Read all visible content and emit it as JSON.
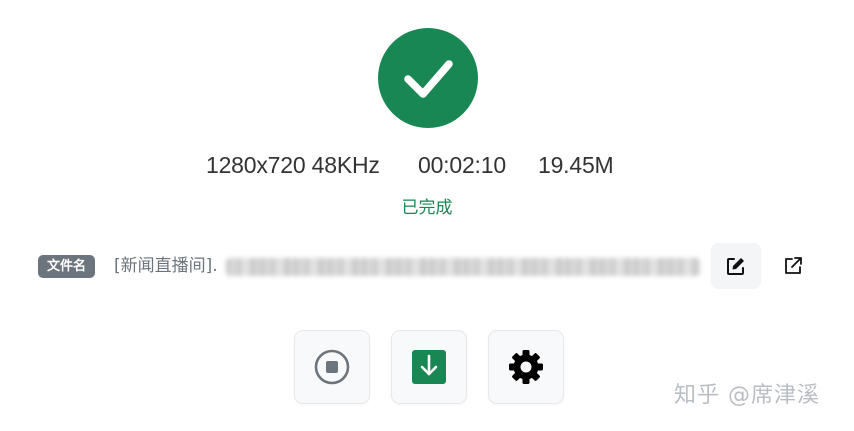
{
  "colors": {
    "success": "#198754",
    "secondary": "#6c757d",
    "text": "#333333",
    "button_bg": "#f8f9fa"
  },
  "status": {
    "icon": "checkmark-icon",
    "resolution_audio": "1280x720 48KHz",
    "duration": "00:02:10",
    "file_size": "19.45M",
    "state_label": "已完成"
  },
  "filename": {
    "badge_label": "文件名",
    "prefix": "[新闻直播间]."
  },
  "actions": {
    "edit_icon": "edit-icon",
    "open_external_icon": "external-link-icon",
    "stop_icon": "stop-circle-icon",
    "download_icon": "download-icon",
    "settings_icon": "gear-icon"
  },
  "watermark": "知乎 @席津溪"
}
